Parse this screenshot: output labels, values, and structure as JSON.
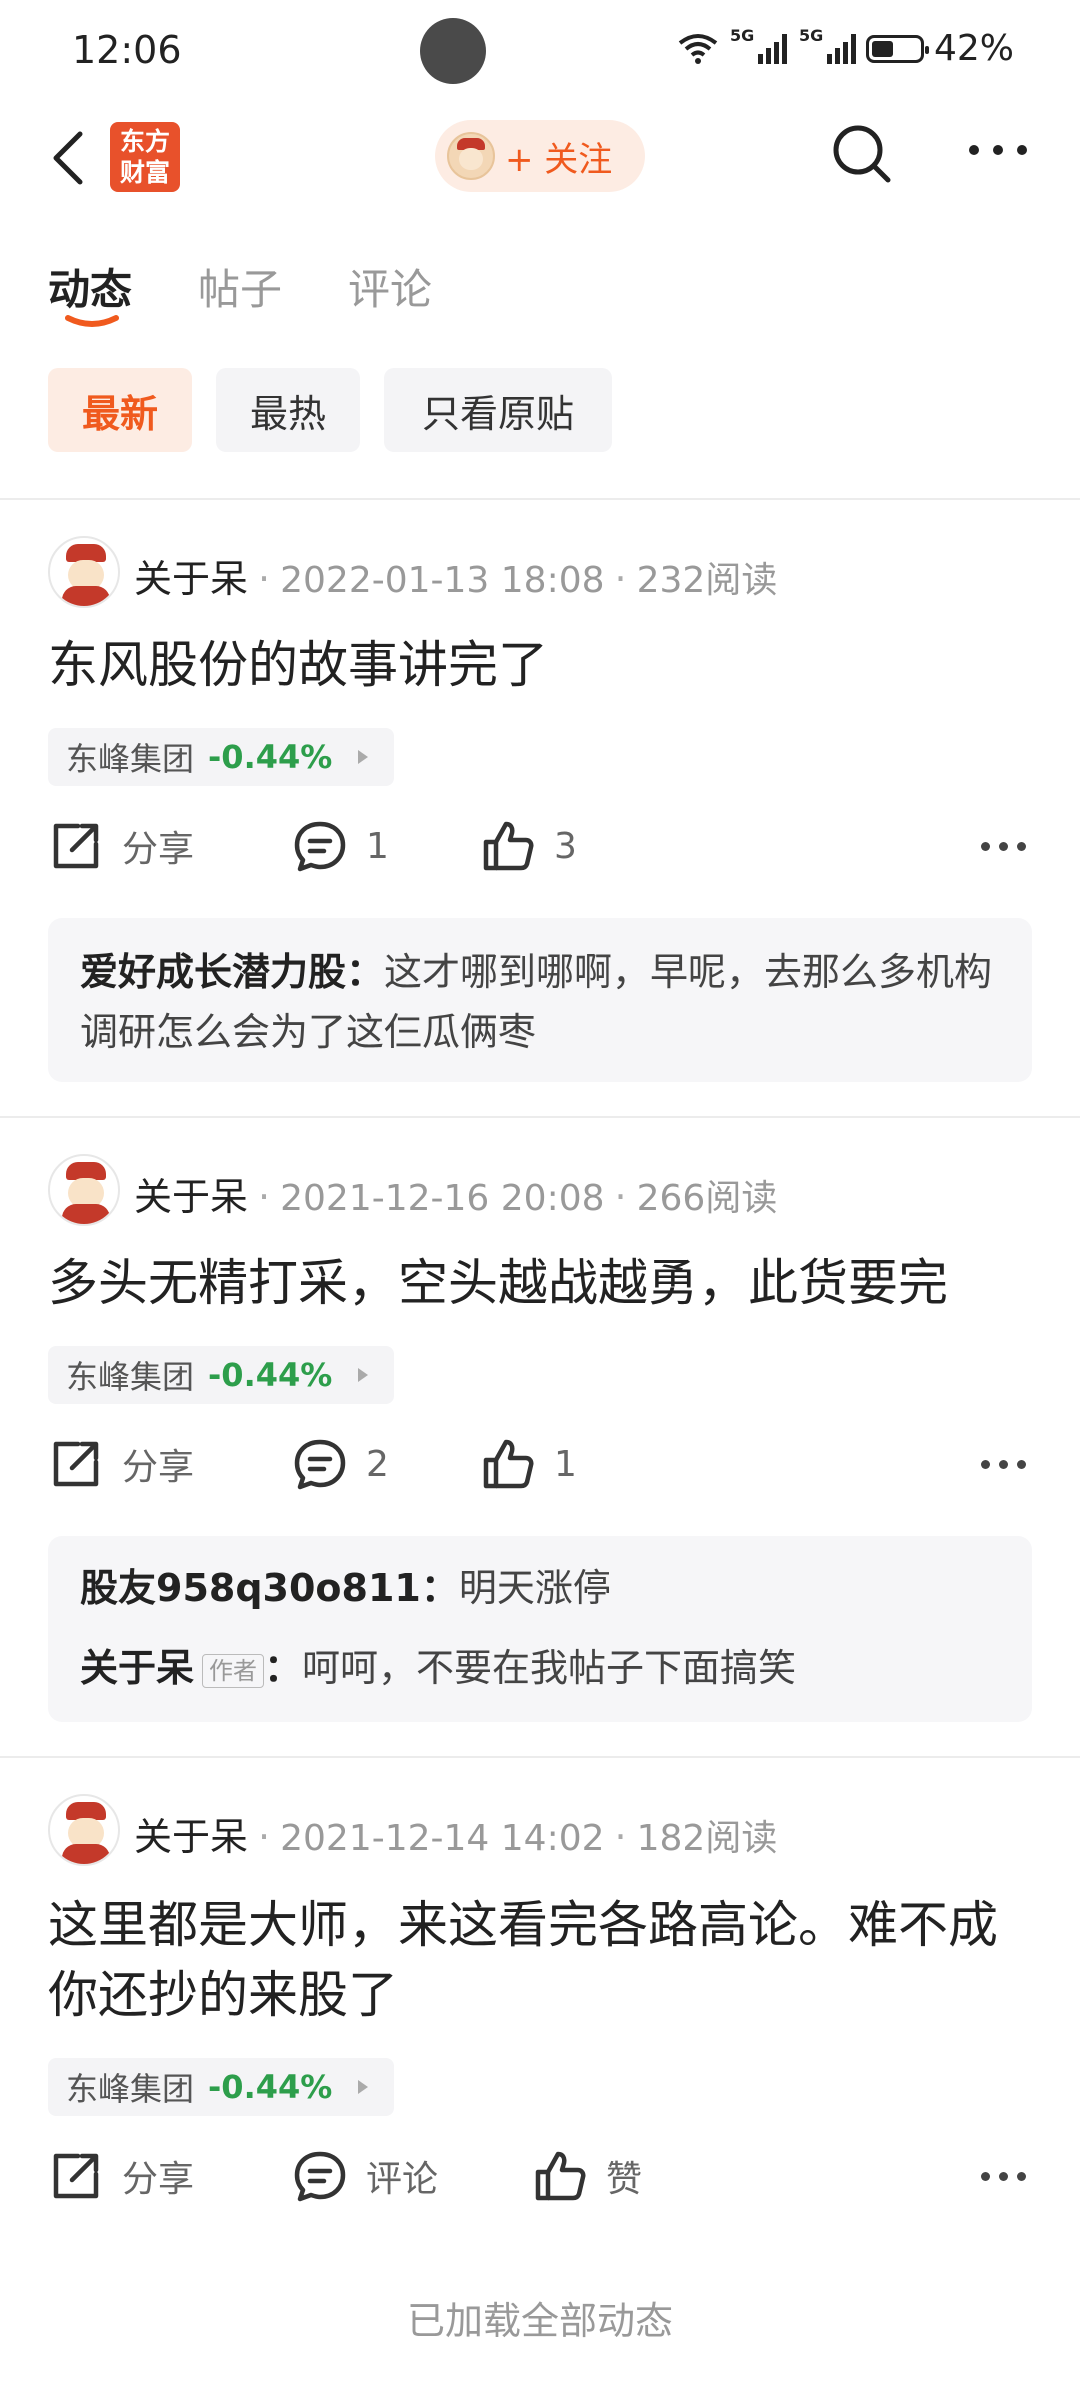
{
  "status_bar": {
    "time": "12:06",
    "battery": "42%",
    "network": "5G"
  },
  "header": {
    "logo_text": "东方财富",
    "follow_label": "+ 关注"
  },
  "tabs": [
    {
      "label": "动态",
      "active": true
    },
    {
      "label": "帖子",
      "active": false
    },
    {
      "label": "评论",
      "active": false
    }
  ],
  "filters": [
    {
      "label": "最新",
      "active": true
    },
    {
      "label": "最热",
      "active": false
    },
    {
      "label": "只看原贴",
      "active": false
    }
  ],
  "posts": [
    {
      "author": "关于呆",
      "time": "2022-01-13 18:08",
      "reads": "232阅读",
      "title": "东风股份的故事讲完了",
      "stock": {
        "name": "东峰集团",
        "change": "-0.44%"
      },
      "share_label": "分享",
      "comment_label": "1",
      "like_label": "3",
      "comments": [
        {
          "user": "爱好成长潜力股",
          "text": "这才哪到哪啊，早呢，去那么多机构调研怎么会为了这仨瓜俩枣"
        }
      ]
    },
    {
      "author": "关于呆",
      "time": "2021-12-16 20:08",
      "reads": "266阅读",
      "title": "多头无精打采，空头越战越勇，此货要完",
      "stock": {
        "name": "东峰集团",
        "change": "-0.44%"
      },
      "share_label": "分享",
      "comment_label": "2",
      "like_label": "1",
      "comments": [
        {
          "user": "股友958q30o811",
          "text": "明天涨停"
        },
        {
          "user": "关于呆",
          "tag": "作者",
          "text": "呵呵，不要在我帖子下面搞笑"
        }
      ]
    },
    {
      "author": "关于呆",
      "time": "2021-12-14 14:02",
      "reads": "182阅读",
      "title": "这里都是大师，来这看完各路高论。难不成你还抄的来股了",
      "stock": {
        "name": "东峰集团",
        "change": "-0.44%"
      },
      "share_label": "分享",
      "comment_label": "评论",
      "like_label": "赞",
      "comments": []
    }
  ],
  "colon": "：",
  "footer_text": "已加载全部动态"
}
